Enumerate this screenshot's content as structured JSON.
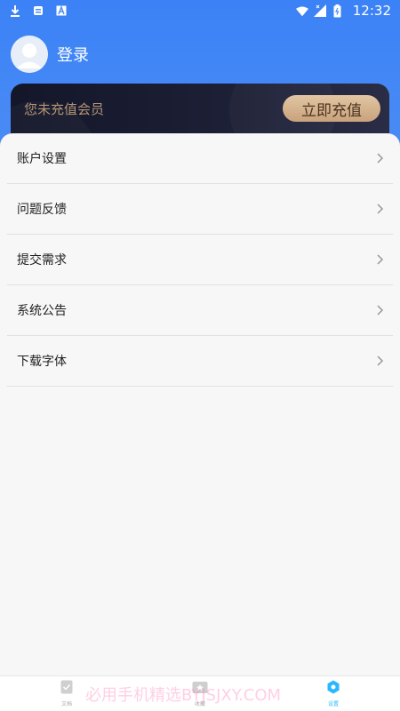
{
  "status_bar": {
    "time": "12:32",
    "left_icons": [
      "download-icon",
      "sd-card-icon",
      "font-a-icon"
    ],
    "right_icons": [
      "wifi-icon",
      "signal-icon",
      "battery-icon"
    ]
  },
  "user": {
    "login_label": "登录"
  },
  "member": {
    "status_text": "您未充值会员",
    "recharge_label": "立即充值"
  },
  "menu": {
    "items": [
      {
        "label": "账户设置"
      },
      {
        "label": "问题反馈"
      },
      {
        "label": "提交需求"
      },
      {
        "label": "系统公告"
      },
      {
        "label": "下载字体"
      }
    ]
  },
  "bottom_tabs": [
    {
      "label": "文档",
      "icon": "document-icon"
    },
    {
      "label": "收藏",
      "icon": "favorites-icon"
    },
    {
      "label": "设置",
      "icon": "settings-icon",
      "active": true
    }
  ],
  "watermark": "必用手机精选BYJSJXY.COM",
  "colors": {
    "header_blue": "#3b82f6",
    "card_dark": "#14162a",
    "gold": "#c8a27b",
    "active_tab": "#2ab7ff"
  }
}
